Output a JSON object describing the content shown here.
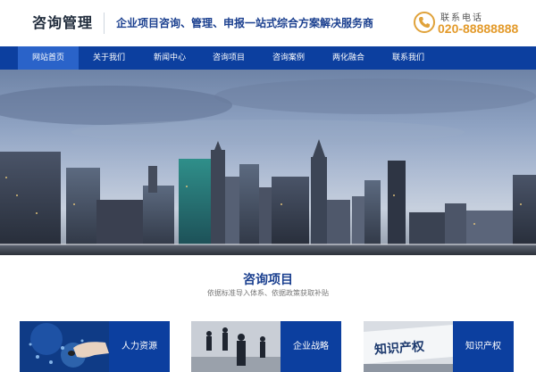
{
  "header": {
    "logo_text": "咨询管理",
    "slogan": "企业项目咨询、管理、申报一站式综合方案解决服务商",
    "phone_label": "联系电话",
    "phone_number": "020-88888888",
    "accent_color": "#e39a2a"
  },
  "nav": {
    "items": [
      {
        "label": "网站首页",
        "active": true
      },
      {
        "label": "关于我们"
      },
      {
        "label": "新闻中心"
      },
      {
        "label": "咨询项目"
      },
      {
        "label": "咨询案例"
      },
      {
        "label": "两化融合"
      },
      {
        "label": "联系我们"
      }
    ],
    "color": "#0c3f9f"
  },
  "section": {
    "title": "咨询项目",
    "subtitle": "依据标准导入体系、依据政策获取补贴"
  },
  "cards": [
    {
      "label": "人力资源",
      "image": "hand-touch-tech"
    },
    {
      "label": "企业战略",
      "image": "business-people"
    },
    {
      "label": "知识产权",
      "image": "intellectual-property-text"
    }
  ],
  "card_image_text": "知识产权"
}
